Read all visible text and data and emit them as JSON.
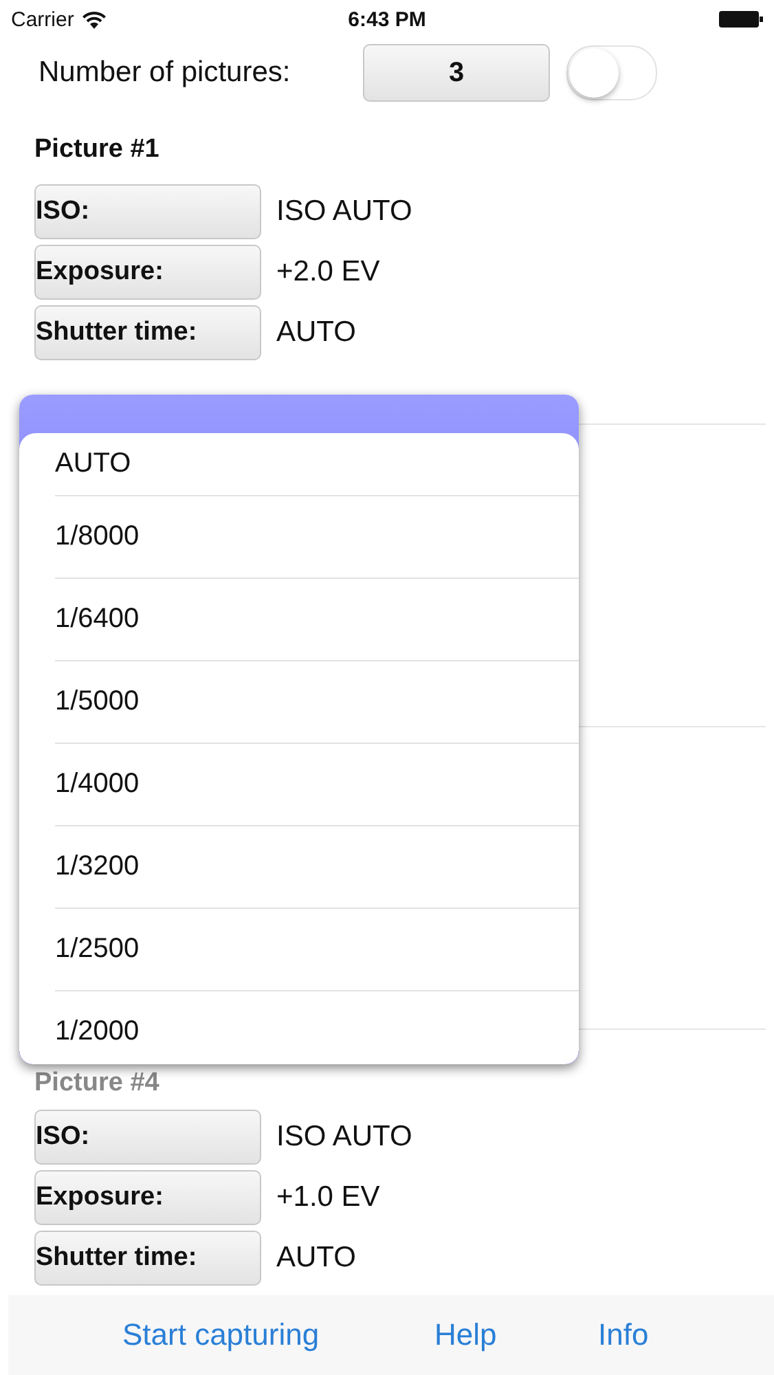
{
  "status_bar": {
    "carrier": "Carrier",
    "time": "6:43 PM"
  },
  "header": {
    "label": "Number of pictures:",
    "count": "3",
    "toggle_on": false
  },
  "sections": [
    {
      "title": "Picture #1",
      "faded": false,
      "rows": [
        {
          "button": "ISO:",
          "value": "ISO AUTO"
        },
        {
          "button": "Exposure:",
          "value": "+2.0 EV"
        },
        {
          "button": "Shutter time:",
          "value": "AUTO"
        }
      ]
    },
    {
      "title": "Picture #4",
      "faded": true,
      "rows": [
        {
          "button": "ISO:",
          "value": "ISO AUTO"
        },
        {
          "button": "Exposure:",
          "value": "+1.0 EV"
        },
        {
          "button": "Shutter time:",
          "value": "AUTO"
        }
      ]
    }
  ],
  "picker": {
    "options": [
      "AUTO",
      "1/8000",
      "1/6400",
      "1/5000",
      "1/4000",
      "1/3200",
      "1/2500",
      "1/2000"
    ]
  },
  "toolbar": [
    "Start capturing",
    "Help",
    "Info"
  ]
}
